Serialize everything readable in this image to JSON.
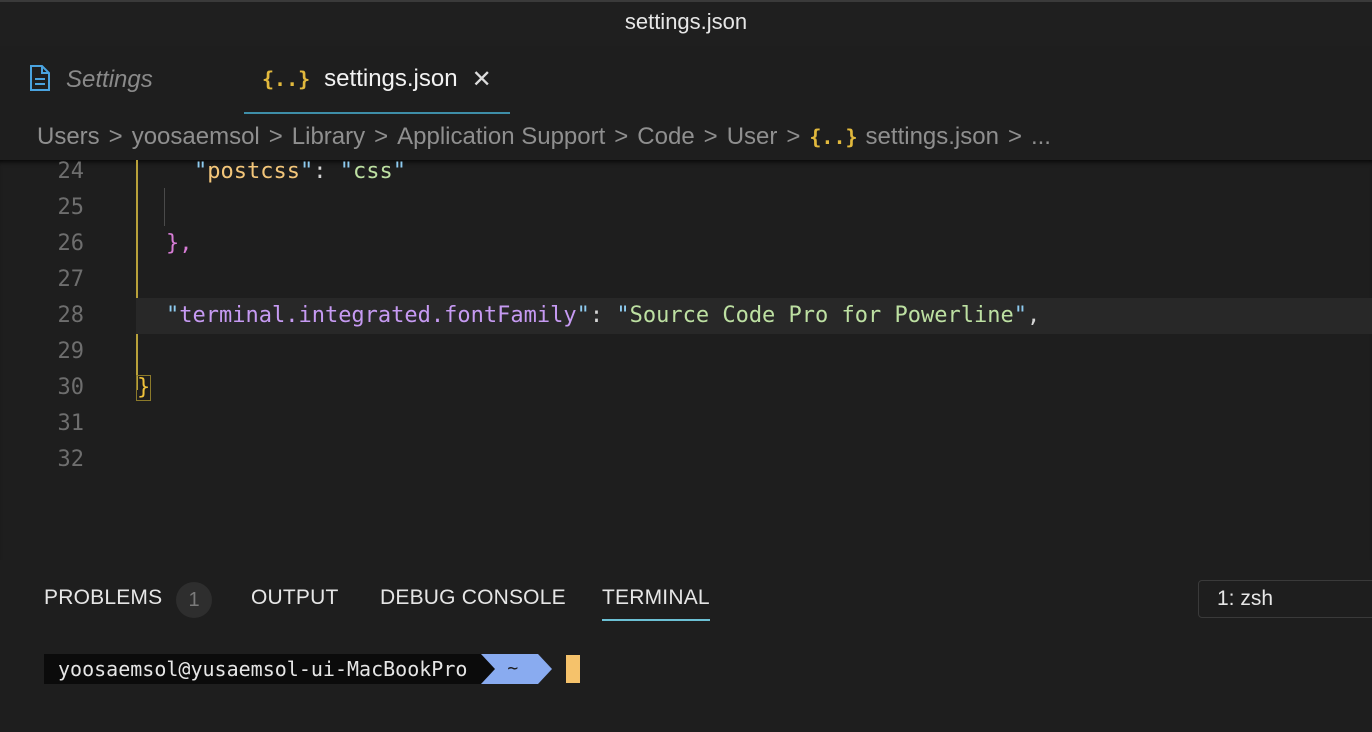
{
  "window": {
    "title": "settings.json"
  },
  "tabs": [
    {
      "label": "Settings",
      "icon": "file-icon",
      "active": false
    },
    {
      "label": "settings.json",
      "icon": "json-braces-icon",
      "active": true,
      "close_glyph": "✕"
    }
  ],
  "breadcrumb": {
    "items": [
      "Users",
      "yoosaemsol",
      "Library",
      "Application Support",
      "Code",
      "User"
    ],
    "file_glyph": "{..}",
    "file": "settings.json",
    "more": "...",
    "separator": ">"
  },
  "editor": {
    "lines": [
      {
        "n": "24",
        "key": "postcss",
        "value": "css"
      },
      {
        "n": "25"
      },
      {
        "n": "26",
        "text": "},"
      },
      {
        "n": "27"
      },
      {
        "n": "28",
        "key": "terminal.integrated.fontFamily",
        "value": "Source Code Pro for Powerline",
        "trailing": ","
      },
      {
        "n": "29"
      },
      {
        "n": "30",
        "text": "}"
      },
      {
        "n": "31"
      },
      {
        "n": "32"
      }
    ],
    "colon": ":",
    "quote": "\""
  },
  "panel": {
    "tabs": [
      "PROBLEMS",
      "OUTPUT",
      "DEBUG CONSOLE",
      "TERMINAL"
    ],
    "active_tab": "TERMINAL",
    "problems_count": "1",
    "terminal_select": "1: zsh"
  },
  "terminal": {
    "user_host": "yoosaemsol@yusaemsol-ui-MacBookPro",
    "cwd": "~"
  },
  "colors": {
    "accent": "#3e8ea8",
    "json_icon": "#e2b93d",
    "prompt_dir_bg": "#89abf0",
    "cursor": "#f5c26b"
  }
}
